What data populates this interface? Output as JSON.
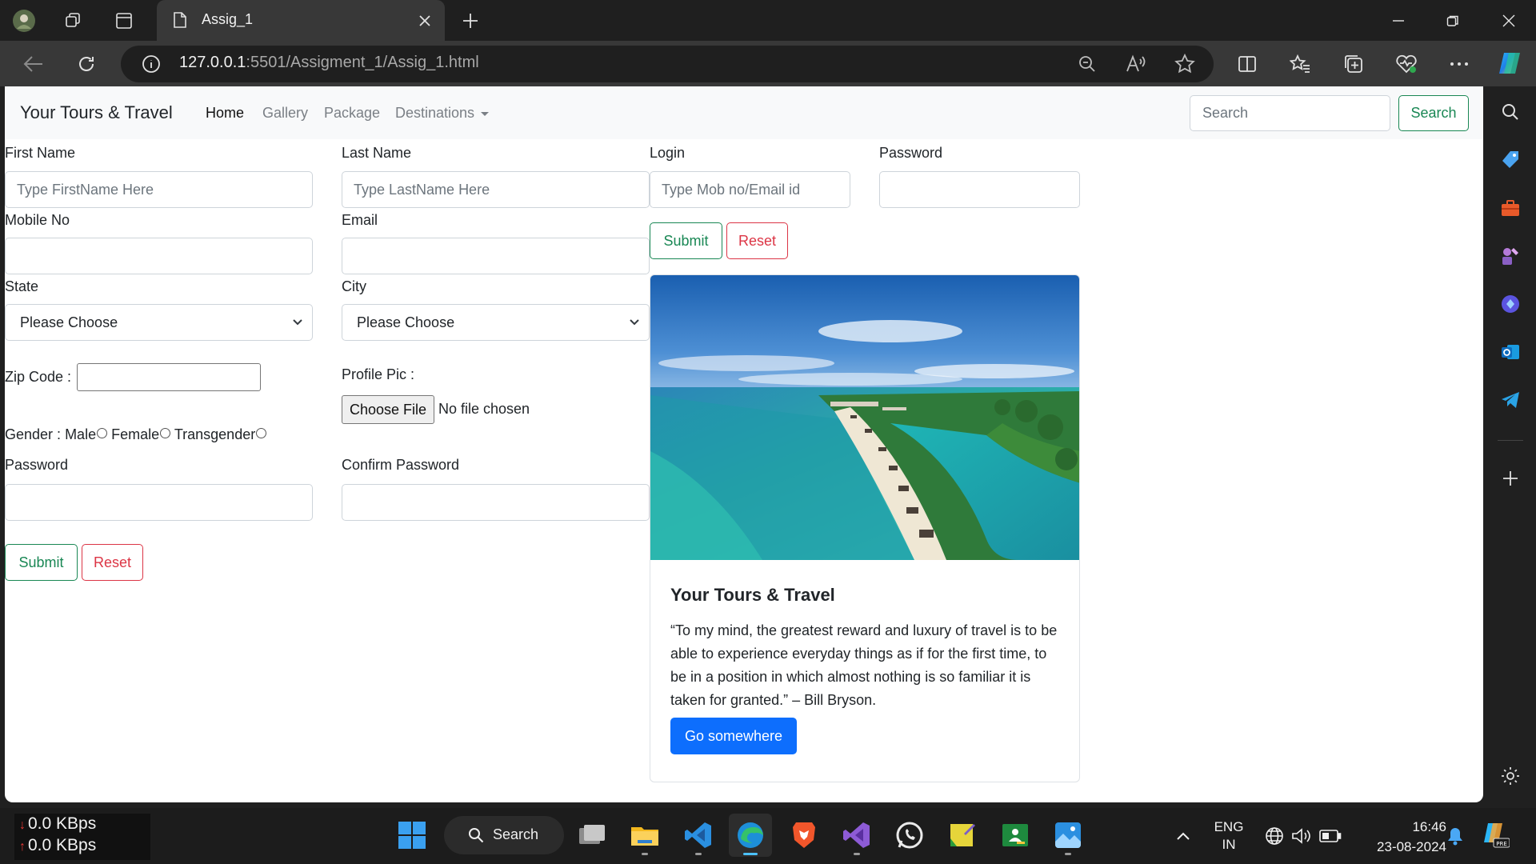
{
  "browser": {
    "tab_title": "Assig_1",
    "url_host": "127.0.0.1",
    "url_path": ":5501/Assigment_1/Assig_1.html"
  },
  "navbar": {
    "brand": "Your Tours & Travel",
    "links": [
      "Home",
      "Gallery",
      "Package",
      "Destinations"
    ],
    "search_placeholder": "Search",
    "search_button": "Search"
  },
  "form": {
    "first_name_label": "First Name",
    "first_name_placeholder": "Type FirstName Here",
    "last_name_label": "Last Name",
    "last_name_placeholder": "Type LastName Here",
    "mobile_label": "Mobile No",
    "email_label": "Email",
    "state_label": "State",
    "state_value": "Please Choose",
    "city_label": "City",
    "city_value": "Please Choose",
    "zip_label": "Zip Code :",
    "profile_label": "Profile Pic :",
    "file_button": "Choose File",
    "file_status": "No file chosen",
    "gender_label": "Gender :",
    "gender_options": [
      "Male",
      "Female",
      "Transgender"
    ],
    "password_label": "Password",
    "confirm_password_label": "Confirm Password",
    "submit": "Submit",
    "reset": "Reset"
  },
  "login": {
    "login_label": "Login",
    "login_placeholder": "Type Mob no/Email id",
    "password_label": "Password",
    "submit": "Submit",
    "reset": "Reset"
  },
  "card": {
    "title": "Your Tours & Travel",
    "text": "“To my mind, the greatest reward and luxury of travel is to be able to experience everyday things as if for the first time, to be in a position in which almost nothing is so familiar it is taken for granted.” – Bill Bryson.",
    "button": "Go somewhere"
  },
  "taskbar": {
    "net_down": "0.0 KBps",
    "net_up": "0.0 KBps",
    "search": "Search",
    "lang_1": "ENG",
    "lang_2": "IN",
    "time": "16:46",
    "date": "23-08-2024"
  },
  "colors": {
    "success": "#198754",
    "danger": "#dc3545",
    "primary": "#0d6efd"
  }
}
